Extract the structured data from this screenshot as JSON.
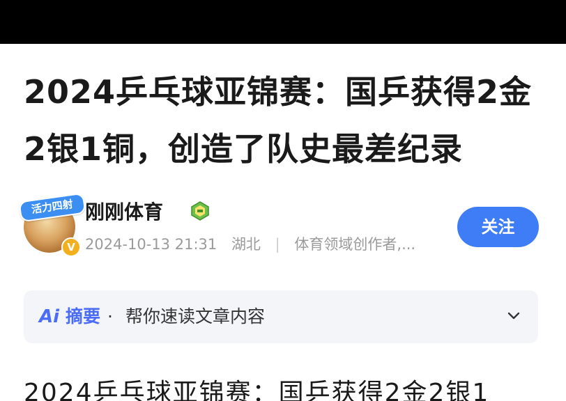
{
  "article": {
    "title": "2024乒乓球亚锦赛：国乒获得2金2银1铜，创造了队史最差纪录",
    "body_preview": "2024乒乓球亚锦赛：国乒获得2金2银1"
  },
  "author": {
    "avatar_badge": "活力四射",
    "name": "刚刚体育",
    "datetime": "2024-10-13 21:31",
    "location": "湖北",
    "description": "体育领域创作者,..."
  },
  "follow_label": "关注",
  "summary": {
    "ai_icon": "Ai",
    "label": "摘要",
    "dot": "·",
    "description": "帮你速读文章内容"
  },
  "colors": {
    "accent": "#3f7df6",
    "ai": "#4a6cf7",
    "verified": "#f2b01e"
  },
  "icons": [
    "verified-icon",
    "level-badge-icon",
    "chevron-down-icon"
  ]
}
